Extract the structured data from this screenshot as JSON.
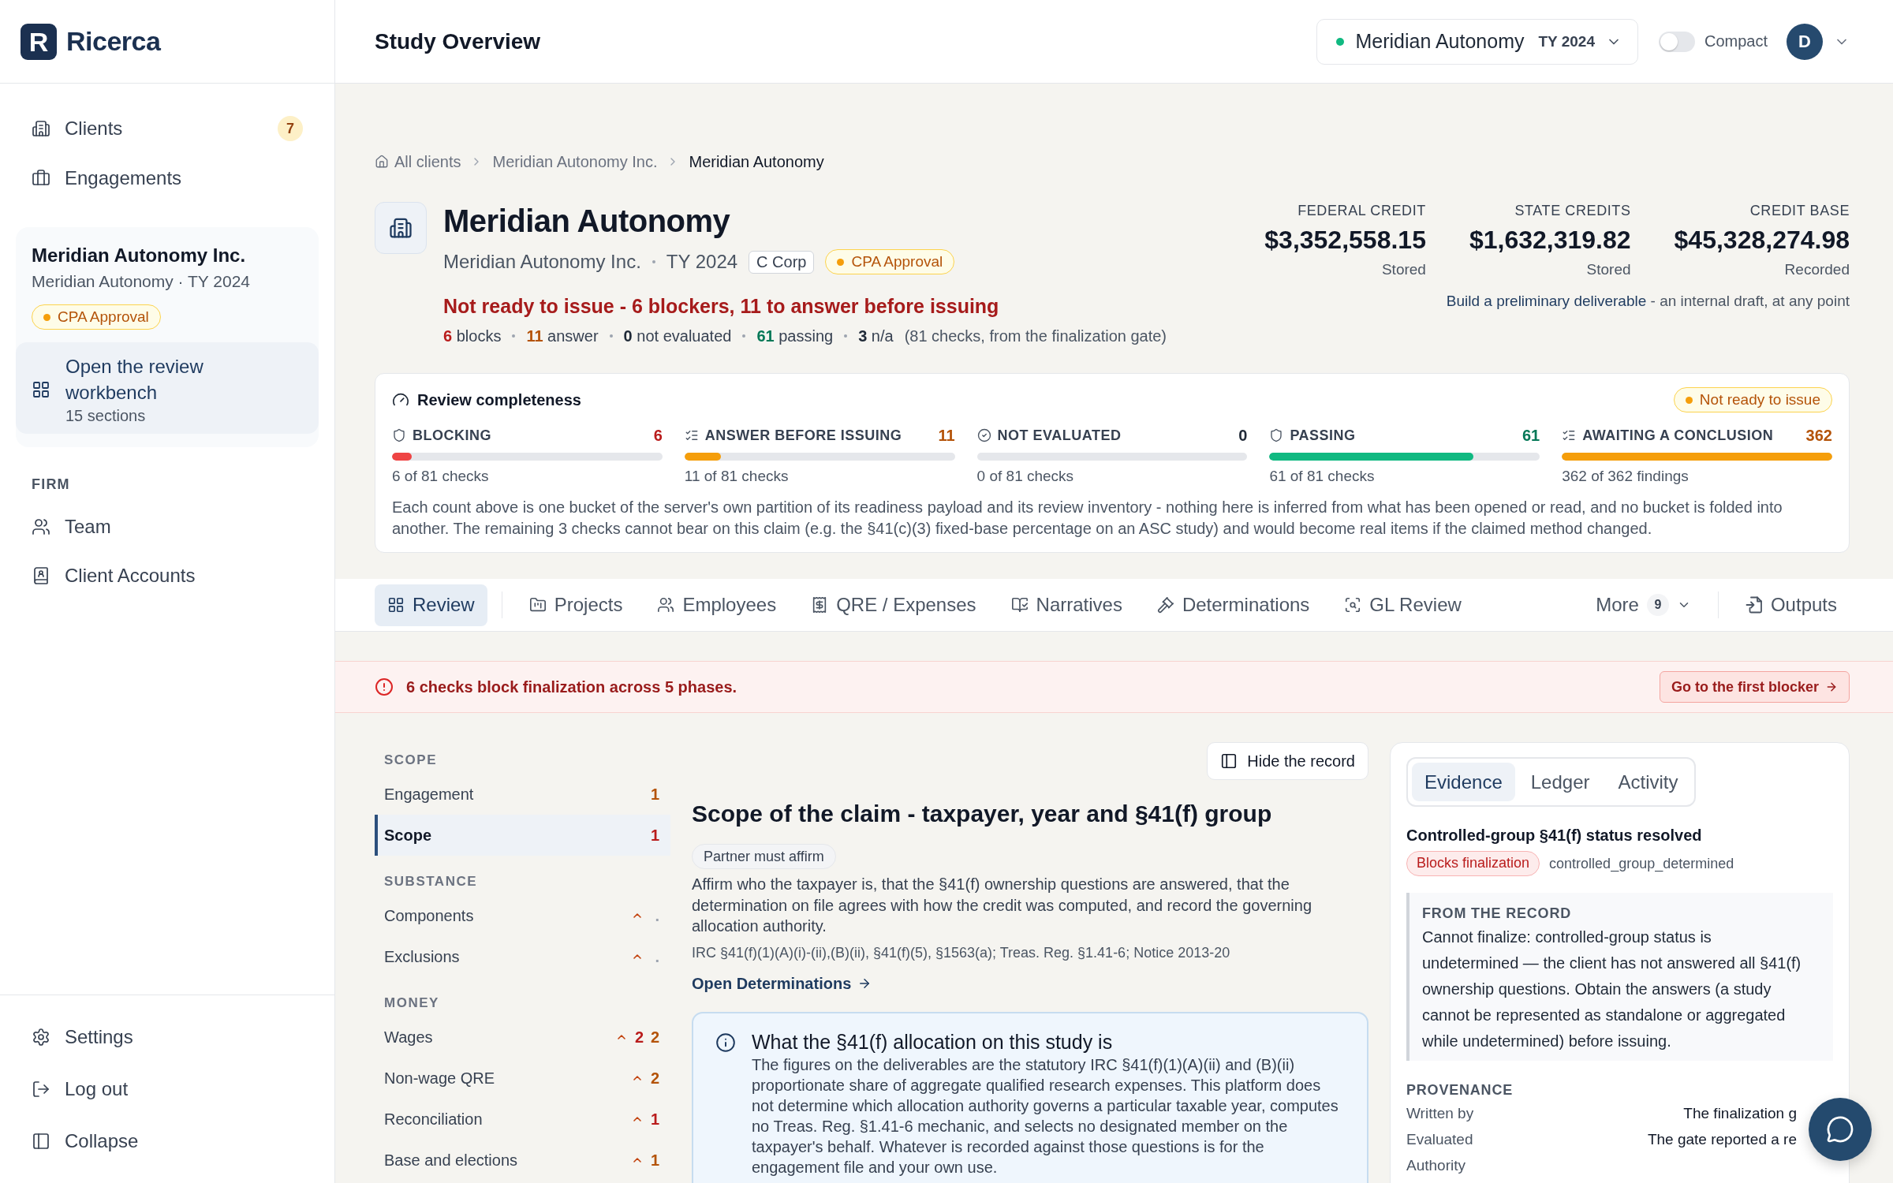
{
  "sidebar": {
    "logo_letter": "R",
    "brand": "Ricerca",
    "nav": [
      {
        "label": "Clients",
        "badge": "7",
        "selected": false
      },
      {
        "label": "Engagements",
        "selected": false
      }
    ],
    "client_card": {
      "name": "Meridian Autonomy Inc.",
      "subtitle": "Meridian Autonomy · TY 2024",
      "status": "CPA Approval",
      "workbench": {
        "title": "Open the review workbench",
        "subtitle": "15 sections"
      }
    },
    "firm": {
      "heading": "FIRM",
      "items": [
        {
          "label": "Team",
          "selected": false
        },
        {
          "label": "Client Accounts",
          "selected": false
        }
      ]
    },
    "footer": [
      "Settings",
      "Log out",
      "Collapse"
    ]
  },
  "header": {
    "title": "Study Overview",
    "client_selector": {
      "name": "Meridian Autonomy",
      "year": "TY 2024"
    },
    "compact": {
      "label": "Compact",
      "on": false
    },
    "avatar": "D"
  },
  "breadcrumb": [
    "All clients",
    "Meridian Autonomy Inc.",
    "Meridian Autonomy"
  ],
  "study": {
    "title": "Meridian Autonomy",
    "company": "Meridian Autonomy Inc.",
    "year": "TY 2024",
    "entity_type": "C Corp",
    "status": "CPA Approval",
    "readiness": "Not ready to issue - 6 blockers, 11 to answer before issuing",
    "tallies": [
      {
        "kind": "block",
        "count": "6",
        "label": "blocks"
      },
      {
        "kind": "answer",
        "count": "11",
        "label": "answer"
      },
      {
        "kind": "neutral",
        "count": "0",
        "label": "not evaluated"
      },
      {
        "kind": "pass",
        "count": "61",
        "label": "passing"
      },
      {
        "kind": "neutral",
        "count": "3",
        "label": "n/a"
      }
    ],
    "tally_note": "(81 checks, from the finalization gate)"
  },
  "credits": {
    "items": [
      {
        "label": "FEDERAL CREDIT",
        "value": "$3,352,558.15",
        "note": "Stored"
      },
      {
        "label": "STATE CREDITS",
        "value": "$1,632,319.82",
        "note": "Stored"
      },
      {
        "label": "CREDIT BASE",
        "value": "$45,328,274.98",
        "note": "Recorded"
      }
    ],
    "hint": {
      "link": "Build a preliminary deliverable",
      "text": "- an internal draft, at any point"
    }
  },
  "completeness": {
    "title": "Review completeness",
    "status": "Not ready to issue",
    "buckets": [
      {
        "kind": "block",
        "label": "BLOCKING",
        "count": "6",
        "level": 0.074,
        "caption": "6 of 81 checks"
      },
      {
        "kind": "answer",
        "label": "ANSWER BEFORE ISSUING",
        "count": "11",
        "level": 0.136,
        "caption": "11 of 81 checks"
      },
      {
        "kind": "neutral",
        "label": "NOT EVALUATED",
        "count": "0",
        "level": 0,
        "caption": "0 of 81 checks"
      },
      {
        "kind": "pass",
        "label": "PASSING",
        "count": "61",
        "level": 0.753,
        "caption": "61 of 81 checks"
      },
      {
        "kind": "answer",
        "label": "AWAITING A CONCLUSION",
        "count": "362",
        "level": 1,
        "caption": "362 of 362 findings"
      }
    ],
    "note": "Each count above is one bucket of the server's own partition of its readiness payload and its review inventory - nothing here is inferred from what has been opened or read, and no bucket is folded into another. The remaining 3 checks cannot bear on this claim (e.g. the §41(c)(3) fixed-base percentage on an ASC study) and would become real items if the claimed method changed."
  },
  "tabs": [
    {
      "label": "Review",
      "selected": true
    },
    {
      "label": "Projects",
      "selected": false
    },
    {
      "label": "Employees",
      "selected": false
    },
    {
      "label": "QRE / Expenses",
      "selected": false
    },
    {
      "label": "Narratives",
      "selected": false
    },
    {
      "label": "Determinations",
      "selected": false
    },
    {
      "label": "GL Review",
      "selected": false
    }
  ],
  "more": {
    "label": "More",
    "count": "9"
  },
  "outputs": {
    "label": "Outputs",
    "selected": false
  },
  "alert": {
    "message": "6 checks block finalization across 5 phases.",
    "action": "Go to the first blocker"
  },
  "section_nav": [
    {
      "heading": "SCOPE",
      "items": [
        {
          "label": "Engagement",
          "selected": false,
          "caret": false,
          "counts": [
            {
              "kind": "answer",
              "text": "1"
            }
          ]
        },
        {
          "label": "Scope",
          "selected": true,
          "caret": false,
          "counts": [
            {
              "kind": "block",
              "text": "1"
            }
          ]
        }
      ]
    },
    {
      "heading": "SUBSTANCE",
      "items": [
        {
          "label": "Components",
          "selected": false,
          "caret": true,
          "counts": [
            {
              "kind": "muted",
              "text": "."
            }
          ]
        },
        {
          "label": "Exclusions",
          "selected": false,
          "caret": true,
          "counts": [
            {
              "kind": "muted",
              "text": "."
            }
          ]
        }
      ]
    },
    {
      "heading": "MONEY",
      "items": [
        {
          "label": "Wages",
          "selected": false,
          "caret": true,
          "counts": [
            {
              "kind": "block",
              "text": "2"
            },
            {
              "kind": "answer",
              "text": "2"
            }
          ]
        },
        {
          "label": "Non-wage QRE",
          "selected": false,
          "caret": true,
          "counts": [
            {
              "kind": "answer",
              "text": "2"
            }
          ]
        },
        {
          "label": "Reconciliation",
          "selected": false,
          "caret": true,
          "counts": [
            {
              "kind": "block",
              "text": "1"
            }
          ]
        },
        {
          "label": "Base and elections",
          "selected": false,
          "caret": true,
          "counts": [
            {
              "kind": "answer",
              "text": "1"
            }
          ]
        }
      ]
    }
  ],
  "section": {
    "hide_button": "Hide the record",
    "title": "Scope of the claim - taxpayer, year and §41(f) group",
    "tag": "Partner must affirm",
    "description": "Affirm who the taxpayer is, that the §41(f) ownership questions are answered, that the determination on file agrees with how the credit was computed, and record the governing allocation authority.",
    "citation": "IRC §41(f)(1)(A)(i)-(ii),(B)(ii), §41(f)(5), §1563(a); Treas. Reg. §1.41-6; Notice 2013-20",
    "link": "Open Determinations",
    "callout": {
      "title": "What the §41(f) allocation on this study is",
      "text": "The figures on the deliverables are the statutory IRC §41(f)(1)(A)(ii) and (B)(ii) proportionate share of aggregate qualified research expenses. This platform does not determine which allocation authority governs a particular taxable year, computes no Treas. Reg. §1.41-6 mechanic, and selects no designated member on the taxpayer's behalf. Whatever is recorded against those questions is for the engagement file and your own use."
    }
  },
  "evidence": {
    "tabs": [
      {
        "label": "Evidence",
        "selected": true
      },
      {
        "label": "Ledger",
        "selected": false
      },
      {
        "label": "Activity",
        "selected": false
      }
    ],
    "check_title": "Controlled-group §41(f) status resolved",
    "severity": {
      "kind": "block",
      "label": "Blocks finalization"
    },
    "check_id": "controlled_group_determined",
    "record": {
      "heading": "FROM THE RECORD",
      "text": "Cannot finalize: controlled-group status is undetermined — the client has not answered all §41(f) ownership questions. Obtain the answers (a study cannot be represented as standalone or aggregated while undetermined) before issuing."
    },
    "provenance": {
      "heading": "PROVENANCE",
      "rows": [
        {
          "label": "Written by",
          "value": "The finalization g"
        },
        {
          "label": "Evaluated",
          "value": "The gate reported a re"
        },
        {
          "label": "Authority"
        }
      ]
    }
  }
}
